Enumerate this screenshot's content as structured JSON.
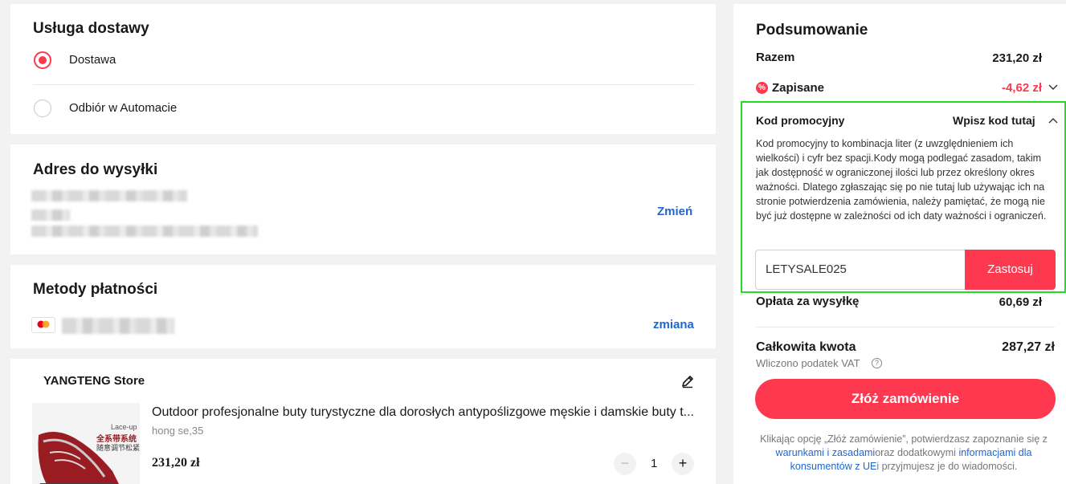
{
  "delivery": {
    "title": "Usługa dostawy",
    "options": [
      {
        "label": "Dostawa",
        "selected": true
      },
      {
        "label": "Odbiór w Automacie",
        "selected": false
      }
    ]
  },
  "address": {
    "title": "Adres do wysyłki",
    "change_label": "Zmień"
  },
  "payment": {
    "title": "Metody płatności",
    "change_label": "zmiana",
    "card_brand_icon": "mastercard-icon"
  },
  "store": {
    "name": "YANGTENG Store",
    "edit_icon": "pencil-icon",
    "product": {
      "title": "Outdoor profesjonalne buty turystyczne dla dorosłych antypoślizgowe męskie i damskie buty t...",
      "variant": "hong se,35",
      "price": "231,20 zł",
      "quantity": "1",
      "image_text_1": "Lace-up",
      "image_text_2": "全系带系统",
      "image_text_3": "随意调节松紧"
    }
  },
  "summary": {
    "title": "Podsumowanie",
    "subtotal_label": "Razem",
    "subtotal_value": "231,20 zł",
    "saved_label": "Zapisane",
    "saved_value": "-4,62 zł",
    "promo": {
      "label": "Kod promocyjny",
      "toggle_label": "Wpisz kod tutaj",
      "description": "Kod promocyjny to kombinacja liter (z uwzględnieniem ich wielkości) i cyfr bez spacji.Kody mogą podlegać zasadom, takim jak dostępność w ograniczonej ilości lub przez określony okres ważności. Dlatego zgłaszając się po nie tutaj lub używając ich na stronie potwierdzenia zamówienia, należy pamiętać, że mogą nie być już dostępne w zależności od ich daty ważności i ograniczeń.",
      "code_value": "LETYSALE025",
      "apply_label": "Zastosuj"
    },
    "shipping_label": "Opłata za wysyłkę",
    "shipping_value": "60,69 zł",
    "total_label": "Całkowita kwota",
    "total_value": "287,27 zł",
    "vat_note": "Wliczono podatek VAT",
    "place_order_label": "Złóż zamówienie",
    "legal_part1": "Klikając opcję „Złóż zamówienie”, potwierdzasz zapoznanie się z ",
    "legal_link1": "warunkami i zasadami",
    "legal_part2": "oraz dodatkowymi ",
    "legal_link2": "informacjami dla konsumentów z UE",
    "legal_part3": "i przyjmujesz je do wiadomości."
  },
  "colors": {
    "accent": "#fd384f",
    "link": "#1f66d1",
    "highlight_border": "#22dd22"
  }
}
